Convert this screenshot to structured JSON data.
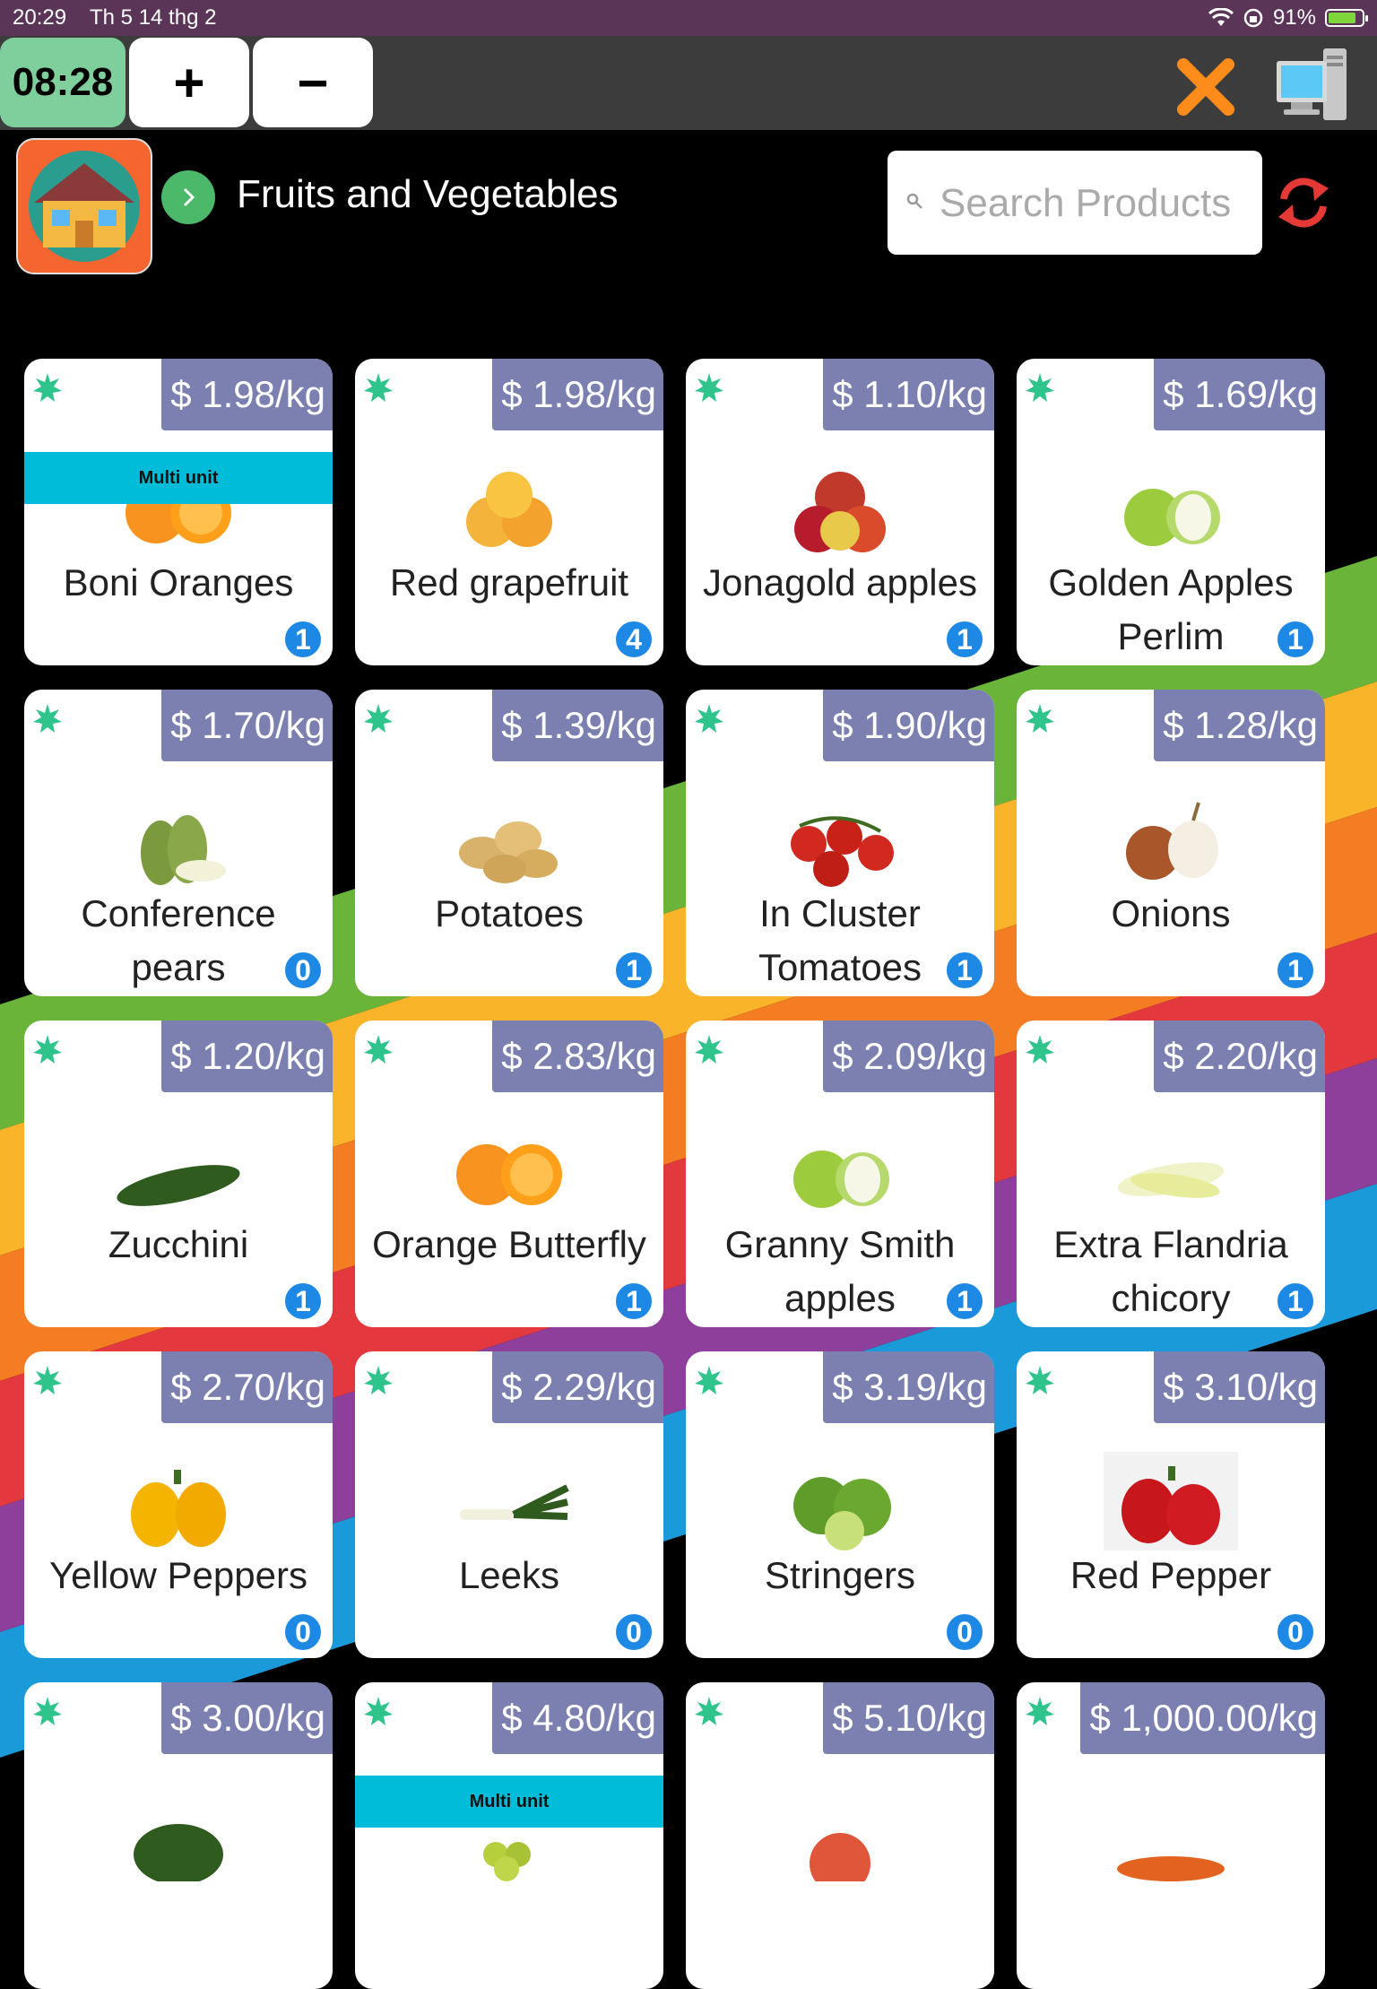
{
  "status_bar": {
    "time": "20:29",
    "date": "Th 5 14 thg 2",
    "battery": "91%"
  },
  "toolbar": {
    "clock": "08:28",
    "plus": "+",
    "minus": "−"
  },
  "header": {
    "title": "Fruits and Vegetables"
  },
  "search": {
    "placeholder": "Search Products"
  },
  "colors": {
    "tile_price_bg": "#7c80b0",
    "multi_unit_bg": "#00bcd8",
    "count_badge": "#1e88e5",
    "clock_bg": "#7fcf9c",
    "close_icon": "#ff8c1a",
    "refresh_icon": "#e53935"
  },
  "products": [
    {
      "name": "Boni Oranges",
      "price": "$ 1.98/kg",
      "count": "1",
      "multi": "Multi unit",
      "icon": "orange"
    },
    {
      "name": "Red grapefruit",
      "price": "$ 1.98/kg",
      "count": "4",
      "multi": "",
      "icon": "grapefruit"
    },
    {
      "name": "Jonagold apples",
      "price": "$ 1.10/kg",
      "count": "1",
      "multi": "",
      "icon": "apple-red"
    },
    {
      "name": "Golden Apples Perlim",
      "price": "$ 1.69/kg",
      "count": "1",
      "multi": "",
      "icon": "apple-green"
    },
    {
      "name": "Conference pears",
      "price": "$ 1.70/kg",
      "count": "0",
      "multi": "",
      "icon": "pear"
    },
    {
      "name": "Potatoes",
      "price": "$ 1.39/kg",
      "count": "1",
      "multi": "",
      "icon": "potato"
    },
    {
      "name": "In Cluster Tomatoes",
      "price": "$ 1.90/kg",
      "count": "1",
      "multi": "",
      "icon": "tomato"
    },
    {
      "name": "Onions",
      "price": "$ 1.28/kg",
      "count": "1",
      "multi": "",
      "icon": "onion"
    },
    {
      "name": "Zucchini",
      "price": "$ 1.20/kg",
      "count": "1",
      "multi": "",
      "icon": "zucchini"
    },
    {
      "name": "Orange Butterfly",
      "price": "$ 2.83/kg",
      "count": "1",
      "multi": "",
      "icon": "orange"
    },
    {
      "name": "Granny Smith apples",
      "price": "$ 2.09/kg",
      "count": "1",
      "multi": "",
      "icon": "apple-green"
    },
    {
      "name": "Extra Flandria chicory",
      "price": "$ 2.20/kg",
      "count": "1",
      "multi": "",
      "icon": "chicory"
    },
    {
      "name": "Yellow Peppers",
      "price": "$ 2.70/kg",
      "count": "0",
      "multi": "",
      "icon": "pepper-yellow"
    },
    {
      "name": "Leeks",
      "price": "$ 2.29/kg",
      "count": "0",
      "multi": "",
      "icon": "leek"
    },
    {
      "name": "Stringers",
      "price": "$ 3.19/kg",
      "count": "0",
      "multi": "",
      "icon": "lime"
    },
    {
      "name": "Red Pepper",
      "price": "$ 3.10/kg",
      "count": "0",
      "multi": "",
      "icon": "pepper-red"
    },
    {
      "name": "",
      "price": "$ 3.00/kg",
      "count": "",
      "multi": "",
      "icon": "pepper-green"
    },
    {
      "name": "",
      "price": "$ 4.80/kg",
      "count": "",
      "multi": "Multi unit",
      "icon": "grapes"
    },
    {
      "name": "",
      "price": "$ 5.10/kg",
      "count": "",
      "multi": "",
      "icon": "peach"
    },
    {
      "name": "",
      "price": "$ 1,000.00/kg",
      "count": "",
      "multi": "",
      "icon": "carrot"
    }
  ]
}
